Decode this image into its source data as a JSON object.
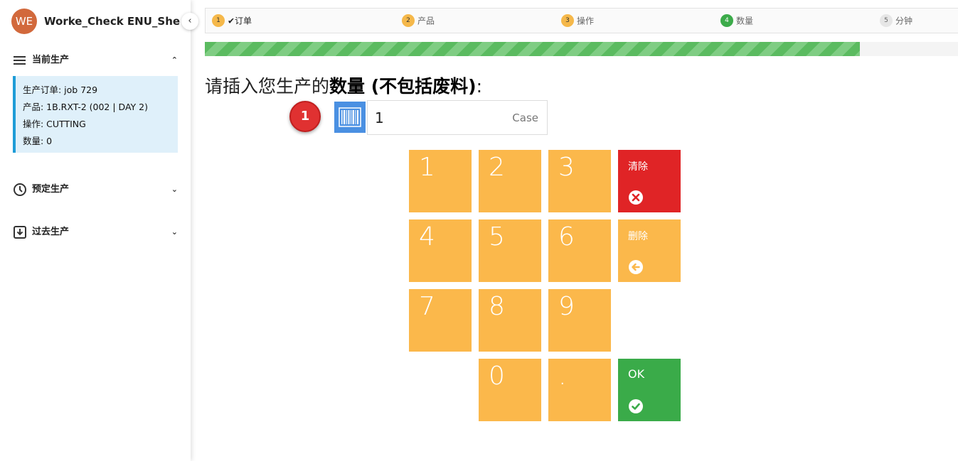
{
  "sidebar": {
    "avatar_initials": "WE",
    "app_title": "Worke_Check ENU_She...",
    "collapse_icon": "chevron-left",
    "sections": {
      "current": {
        "label": "当前生产",
        "icon": "menu-icon",
        "expanded": true
      },
      "scheduled": {
        "label": "预定生产",
        "icon": "clock-icon",
        "expanded": false
      },
      "past": {
        "label": "过去生产",
        "icon": "download-box-icon",
        "expanded": false
      }
    },
    "current_info": {
      "order": "生产订单: job 729",
      "product": "产品: 1B.RXT-2 (002 | DAY 2)",
      "operation": "操作: CUTTING",
      "quantity": "数量: 0"
    }
  },
  "steps": [
    {
      "num": "1",
      "label": "✔订单",
      "state": "done"
    },
    {
      "num": "2",
      "label": "产品",
      "state": "pending"
    },
    {
      "num": "3",
      "label": "操作",
      "state": "pending"
    },
    {
      "num": "4",
      "label": "数量",
      "state": "active"
    },
    {
      "num": "5",
      "label": "分钟",
      "state": "todo"
    }
  ],
  "progress": {
    "fraction": 0.87
  },
  "question": {
    "prefix": "请插入您生产的",
    "bold": "数量 (不包括废料)",
    "suffix": ":"
  },
  "input": {
    "badge": "1",
    "value": "1",
    "unit": "Case",
    "barcode_icon": "barcode-icon"
  },
  "keypad": {
    "digits": [
      "1",
      "2",
      "3",
      "4",
      "5",
      "6",
      "7",
      "8",
      "9",
      "0",
      "."
    ],
    "clear_label": "清除",
    "delete_label": "删除",
    "ok_label": "OK"
  },
  "colors": {
    "key": "#fbb84b",
    "clear": "#e02426",
    "ok": "#3aab49",
    "accent": "#1e9cd7"
  }
}
